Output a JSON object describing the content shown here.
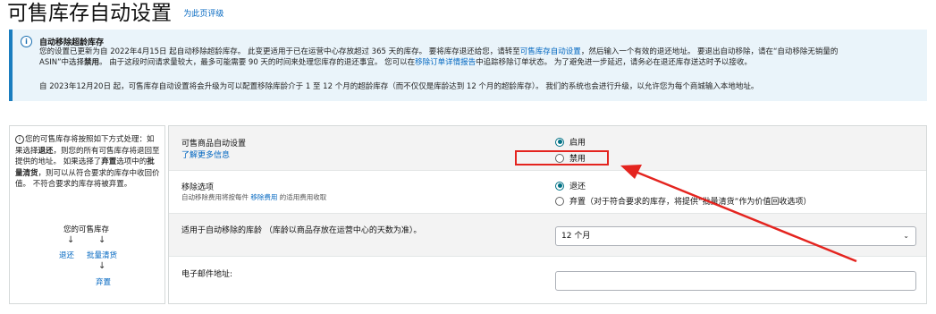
{
  "page": {
    "title": "可售库存自动设置",
    "rate_link": "为此页评级"
  },
  "alert": {
    "title": "自动移除超龄库存",
    "line1_a": "您的设置已更新为自 2022年4月15日 起自动移除超龄库存。 此变更适用于已在运营中心存放超过 365 天的库存。 要将库存退还给您，请转至",
    "line1_link": "可售库存自动设置",
    "line1_b": "，然后输入一个有效的退还地址。 要退出自动移除，请在“自动移除无销量的",
    "line2_a": "ASIN”中选择",
    "line2_bold": "禁用",
    "line2_b": "。 由于这段时间请求量较大，最多可能需要 90 天的时间来处理您库存的退还事宜。 您可以在",
    "line2_link": "移除订单详情报告",
    "line2_c": "中追踪移除订单状态。 为了避免进一步延迟，请务必在退还库存送达时予以接收。",
    "line3": "自 2023年12月20日 起，可售库存自动设置将会升级为可以配置移除库龄介于 1 至 12 个月的超龄库存（而不仅仅是库龄达到 12 个月的超龄库存）。 我们的系统也会进行升级，以允许您为每个商城输入本地地址。"
  },
  "info": {
    "p1": "您的可售库存将按照如下方式处理：如果选择",
    "p1_bold": "退还",
    "p2": "，则您的所有可售库存将退回至提供的地址。 如果选择了",
    "p2_bold1": "弃置",
    "p3": "选项中的",
    "p3_bold2": "批量清货",
    "p4": "，则可以从符合要求的库存中收回价值。 不符合要求的库存将被弃置。",
    "flow_top": "您的可售库存",
    "flow_return": "退还",
    "flow_liquidate": "批量清货",
    "flow_dispose": "弃置"
  },
  "form": {
    "auto": {
      "label": "可售商品自动设置",
      "learn_more": "了解更多信息",
      "options": [
        "启用",
        "禁用"
      ],
      "selected": 0
    },
    "removal": {
      "label": "移除选项",
      "sub_a": "自动移除费用将按每件",
      "sub_link": "移除费用",
      "sub_b": "的适用费用收取",
      "options": [
        "退还",
        "弃置（对于符合要求的库存，将提供“批量清货”作为价值回收选项）"
      ],
      "selected": 0
    },
    "age": {
      "label": "适用于自动移除的库龄 （库龄以商品存放在运营中心的天数为准）。",
      "value": "12 个月"
    },
    "email": {
      "label": "电子邮件地址:",
      "value": ""
    }
  },
  "colors": {
    "accent": "#007185",
    "link": "#0066c0",
    "annotation": "#e4241f",
    "alert_bg": "#eaf4fa"
  }
}
